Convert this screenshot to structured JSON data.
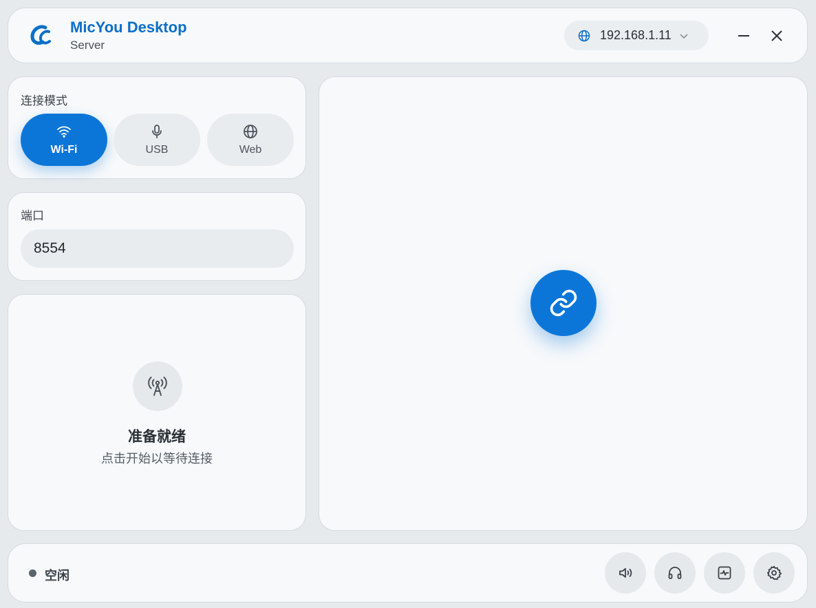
{
  "header": {
    "title": "MicYou Desktop",
    "subtitle": "Server",
    "ip_address": "192.168.1.11",
    "logo_icon": "app-logo",
    "globe_icon": "globe-icon",
    "chevron_icon": "chevron-down-icon",
    "minimize_icon": "minimize-icon",
    "close_icon": "close-icon"
  },
  "connection_mode": {
    "label": "连接模式",
    "selected": "Wi-Fi",
    "options": [
      {
        "label": "Wi-Fi",
        "icon": "wifi-icon"
      },
      {
        "label": "USB",
        "icon": "microphone-icon"
      },
      {
        "label": "Web",
        "icon": "globe-icon"
      }
    ]
  },
  "port": {
    "label": "端口",
    "value": "8554"
  },
  "status": {
    "icon": "broadcast-tower-icon",
    "title": "准备就绪",
    "description": "点击开始以等待连接"
  },
  "main": {
    "connect_icon": "link-icon"
  },
  "footer": {
    "state_text": "空闲",
    "buttons": [
      {
        "icon": "volume-icon"
      },
      {
        "icon": "headphones-icon"
      },
      {
        "icon": "activity-monitor-icon"
      },
      {
        "icon": "gear-icon"
      }
    ]
  },
  "colors": {
    "accent": "#0c76d8",
    "title": "#0b6fc7",
    "background": "#e7eaed",
    "card": "#f7f9fb",
    "status_dot": "#5a646e"
  }
}
